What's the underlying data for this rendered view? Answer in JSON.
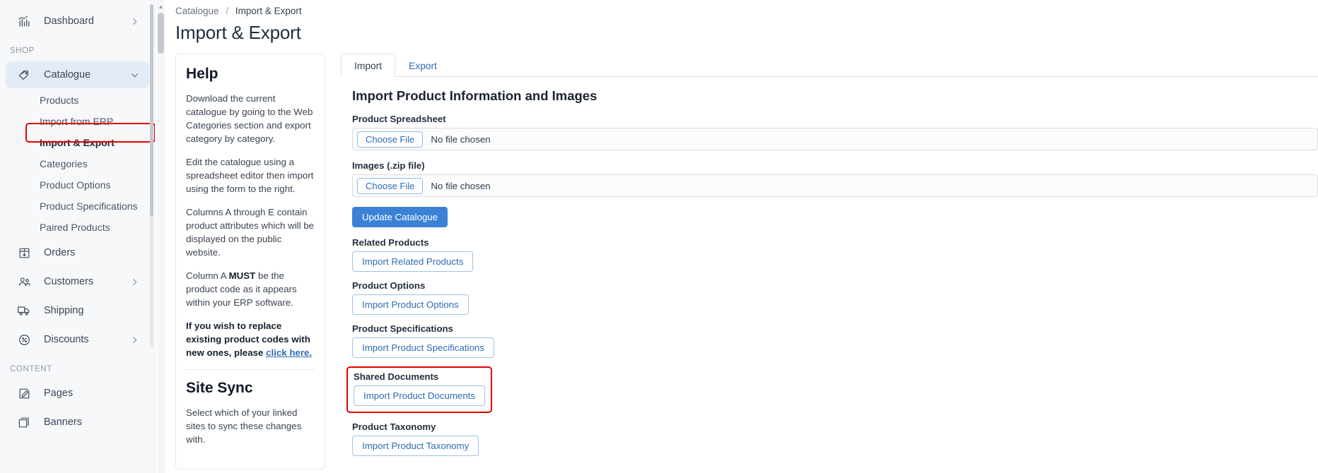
{
  "sidebar": {
    "top_items": [
      {
        "label": "Dashboard",
        "icon": "dashboard-chart-icon",
        "chevron": "chevron-right"
      }
    ],
    "sections": [
      {
        "label": "SHOP",
        "items": [
          {
            "label": "Catalogue",
            "icon": "tag-icon",
            "chevron": "chevron-down",
            "active": true,
            "children": [
              {
                "label": "Products"
              },
              {
                "label": "Import from ERP"
              },
              {
                "label": "Import & Export",
                "highlighted": true
              },
              {
                "label": "Categories"
              },
              {
                "label": "Product Options"
              },
              {
                "label": "Product Specifications"
              },
              {
                "label": "Paired Products"
              }
            ]
          },
          {
            "label": "Orders",
            "icon": "box-download-icon",
            "chevron": ""
          },
          {
            "label": "Customers",
            "icon": "users-icon",
            "chevron": "chevron-right"
          },
          {
            "label": "Shipping",
            "icon": "truck-icon",
            "chevron": ""
          },
          {
            "label": "Discounts",
            "icon": "percent-tag-icon",
            "chevron": "chevron-right"
          }
        ]
      },
      {
        "label": "CONTENT",
        "items": [
          {
            "label": "Pages",
            "icon": "page-edit-icon",
            "chevron": ""
          },
          {
            "label": "Banners",
            "icon": "banners-stack-icon",
            "chevron": ""
          }
        ]
      }
    ]
  },
  "breadcrumb": {
    "parent": "Catalogue",
    "separator": "/",
    "current": "Import & Export"
  },
  "page": {
    "title": "Import & Export"
  },
  "help": {
    "heading": "Help",
    "p1": "Download the current catalogue by going to the Web Categories section and export category by category.",
    "p2": "Edit the catalogue using a spreadsheet editor then import using the form to the right.",
    "p3_a": "Columns A through E contain product attributes which will be displayed on the public website.",
    "p4_a": "Column A ",
    "p4_must": "MUST",
    "p4_b": " be the product code as it appears within your ERP software.",
    "p5_a": "If you wish to replace existing product codes with new ones, please ",
    "p5_link": "click here.",
    "sync_heading": "Site Sync",
    "sync_text": "Select which of your linked sites to sync these changes with."
  },
  "tabs": [
    {
      "label": "Import",
      "active": true
    },
    {
      "label": "Export",
      "active": false
    }
  ],
  "import_panel": {
    "heading": "Import Product Information and Images",
    "spreadsheet_label": "Product Spreadsheet",
    "spreadsheet_button": "Choose File",
    "spreadsheet_filename": "No file chosen",
    "images_label": "Images (.zip file)",
    "images_button": "Choose File",
    "images_filename": "No file chosen",
    "update_button": "Update Catalogue",
    "groups": [
      {
        "label": "Related Products",
        "button": "Import Related Products",
        "boxed": false
      },
      {
        "label": "Product Options",
        "button": "Import Product Options",
        "boxed": false
      },
      {
        "label": "Product Specifications",
        "button": "Import Product Specifications",
        "boxed": false
      },
      {
        "label": "Shared Documents",
        "button": "Import Product Documents",
        "boxed": true
      },
      {
        "label": "Product Taxonomy",
        "button": "Import Product Taxonomy",
        "boxed": false
      }
    ]
  },
  "colors": {
    "accent_blue": "#3b82d6",
    "link_blue": "#2d6cb5",
    "highlight_red": "#e60000",
    "sidebar_bg": "#f7f8fa",
    "active_nav_bg": "#e3ecf6"
  }
}
